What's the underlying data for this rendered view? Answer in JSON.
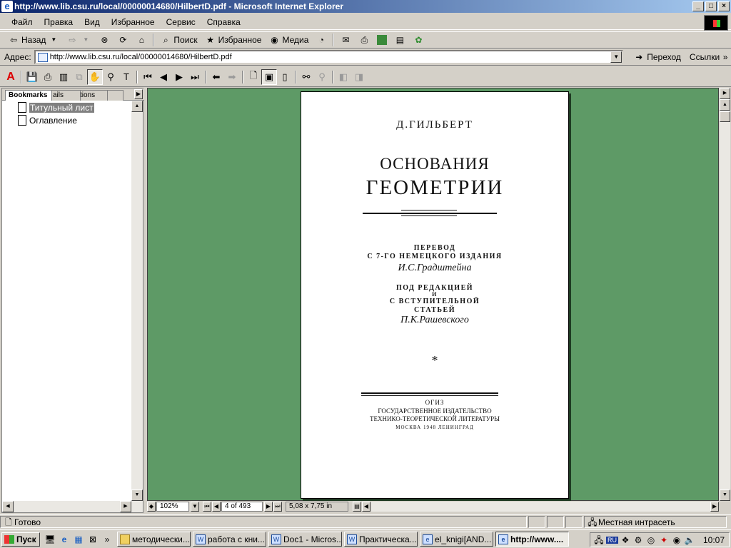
{
  "window": {
    "title": "http://www.lib.csu.ru/local/00000014680/HilbertD.pdf - Microsoft Internet Explorer",
    "controls": {
      "minimize": "_",
      "maximize": "□",
      "close": "×"
    }
  },
  "menu": [
    "Файл",
    "Правка",
    "Вид",
    "Избранное",
    "Сервис",
    "Справка"
  ],
  "toolbar": {
    "back_label": "Назад",
    "search_label": "Поиск",
    "favorites_label": "Избранное",
    "media_label": "Медиа"
  },
  "address": {
    "label": "Адрес:",
    "url": "http://www.lib.csu.ru/local/00000014680/HilbertD.pdf",
    "go_label": "Переход",
    "links_label": "Ссылки"
  },
  "bookmarks_panel": {
    "tabs": [
      "Bookmarks",
      "ails",
      "tions",
      "t"
    ],
    "items": [
      {
        "label": "Титульный лист",
        "selected": true
      },
      {
        "label": "Оглавление",
        "selected": false
      }
    ]
  },
  "document": {
    "author": "Д.ГИЛЬБЕРТ",
    "title_line1": "ОСНОВАНИЯ",
    "title_line2": "ГЕОМЕТРИИ",
    "translation_label": "ПЕРЕВОД",
    "edition": "С 7-ГО НЕМЕЦКОГО ИЗДАНИЯ",
    "translator": "И.С.Градштейна",
    "edited_by": "ПОД РЕДАКЦИЕЙ",
    "and": "И",
    "intro_line1": "С ВСТУПИТЕЛЬНОЙ",
    "intro_line2": "СТАТЬЕЙ",
    "editor": "П.К.Рашевского",
    "star": "*",
    "publisher": "ОГИЗ",
    "publisher_full1": "ГОСУДАРСТВЕННОЕ ИЗДАТЕЛЬСТВО",
    "publisher_full2": "ТЕХНИКО-ТЕОРЕТИЧЕСКОЙ ЛИТЕРАТУРЫ",
    "city_year": "МОСКВА 1948 ЛЕНИНГРАД"
  },
  "viewer": {
    "zoom": "102%",
    "page_indicator": "4 of 493",
    "page_size": "5,08 x 7,75 in"
  },
  "status": {
    "text": "Готово",
    "zone": "Местная интрасеть"
  },
  "taskbar": {
    "start_label": "Пуск",
    "tasks": [
      {
        "label": "методически...",
        "active": false
      },
      {
        "label": "работа с кни...",
        "active": false
      },
      {
        "label": "Doc1 - Micros...",
        "active": false
      },
      {
        "label": "Практическа...",
        "active": false
      },
      {
        "label": "el_knigi[AND...",
        "active": false
      },
      {
        "label": "http://www....",
        "active": true
      }
    ],
    "lang": "RU",
    "clock": "10:07"
  },
  "colors": {
    "titlebar_start": "#0a246a",
    "titlebar_end": "#a6caf0",
    "doc_background": "#5e9a66",
    "chrome": "#d4d0c8"
  }
}
